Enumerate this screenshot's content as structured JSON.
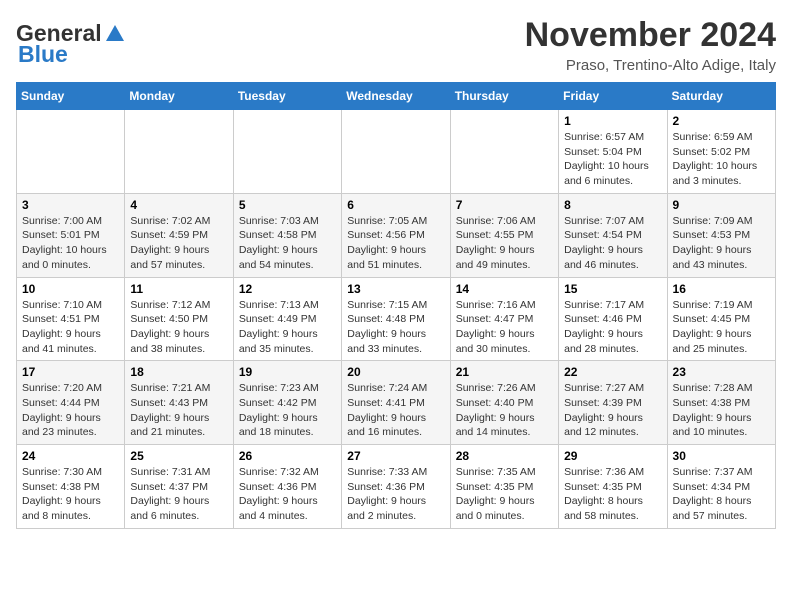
{
  "header": {
    "logo_general": "General",
    "logo_blue": "Blue",
    "month_title": "November 2024",
    "location": "Praso, Trentino-Alto Adige, Italy"
  },
  "weekdays": [
    "Sunday",
    "Monday",
    "Tuesday",
    "Wednesday",
    "Thursday",
    "Friday",
    "Saturday"
  ],
  "weeks": [
    [
      {
        "day": "",
        "info": ""
      },
      {
        "day": "",
        "info": ""
      },
      {
        "day": "",
        "info": ""
      },
      {
        "day": "",
        "info": ""
      },
      {
        "day": "",
        "info": ""
      },
      {
        "day": "1",
        "info": "Sunrise: 6:57 AM\nSunset: 5:04 PM\nDaylight: 10 hours and 6 minutes."
      },
      {
        "day": "2",
        "info": "Sunrise: 6:59 AM\nSunset: 5:02 PM\nDaylight: 10 hours and 3 minutes."
      }
    ],
    [
      {
        "day": "3",
        "info": "Sunrise: 7:00 AM\nSunset: 5:01 PM\nDaylight: 10 hours and 0 minutes."
      },
      {
        "day": "4",
        "info": "Sunrise: 7:02 AM\nSunset: 4:59 PM\nDaylight: 9 hours and 57 minutes."
      },
      {
        "day": "5",
        "info": "Sunrise: 7:03 AM\nSunset: 4:58 PM\nDaylight: 9 hours and 54 minutes."
      },
      {
        "day": "6",
        "info": "Sunrise: 7:05 AM\nSunset: 4:56 PM\nDaylight: 9 hours and 51 minutes."
      },
      {
        "day": "7",
        "info": "Sunrise: 7:06 AM\nSunset: 4:55 PM\nDaylight: 9 hours and 49 minutes."
      },
      {
        "day": "8",
        "info": "Sunrise: 7:07 AM\nSunset: 4:54 PM\nDaylight: 9 hours and 46 minutes."
      },
      {
        "day": "9",
        "info": "Sunrise: 7:09 AM\nSunset: 4:53 PM\nDaylight: 9 hours and 43 minutes."
      }
    ],
    [
      {
        "day": "10",
        "info": "Sunrise: 7:10 AM\nSunset: 4:51 PM\nDaylight: 9 hours and 41 minutes."
      },
      {
        "day": "11",
        "info": "Sunrise: 7:12 AM\nSunset: 4:50 PM\nDaylight: 9 hours and 38 minutes."
      },
      {
        "day": "12",
        "info": "Sunrise: 7:13 AM\nSunset: 4:49 PM\nDaylight: 9 hours and 35 minutes."
      },
      {
        "day": "13",
        "info": "Sunrise: 7:15 AM\nSunset: 4:48 PM\nDaylight: 9 hours and 33 minutes."
      },
      {
        "day": "14",
        "info": "Sunrise: 7:16 AM\nSunset: 4:47 PM\nDaylight: 9 hours and 30 minutes."
      },
      {
        "day": "15",
        "info": "Sunrise: 7:17 AM\nSunset: 4:46 PM\nDaylight: 9 hours and 28 minutes."
      },
      {
        "day": "16",
        "info": "Sunrise: 7:19 AM\nSunset: 4:45 PM\nDaylight: 9 hours and 25 minutes."
      }
    ],
    [
      {
        "day": "17",
        "info": "Sunrise: 7:20 AM\nSunset: 4:44 PM\nDaylight: 9 hours and 23 minutes."
      },
      {
        "day": "18",
        "info": "Sunrise: 7:21 AM\nSunset: 4:43 PM\nDaylight: 9 hours and 21 minutes."
      },
      {
        "day": "19",
        "info": "Sunrise: 7:23 AM\nSunset: 4:42 PM\nDaylight: 9 hours and 18 minutes."
      },
      {
        "day": "20",
        "info": "Sunrise: 7:24 AM\nSunset: 4:41 PM\nDaylight: 9 hours and 16 minutes."
      },
      {
        "day": "21",
        "info": "Sunrise: 7:26 AM\nSunset: 4:40 PM\nDaylight: 9 hours and 14 minutes."
      },
      {
        "day": "22",
        "info": "Sunrise: 7:27 AM\nSunset: 4:39 PM\nDaylight: 9 hours and 12 minutes."
      },
      {
        "day": "23",
        "info": "Sunrise: 7:28 AM\nSunset: 4:38 PM\nDaylight: 9 hours and 10 minutes."
      }
    ],
    [
      {
        "day": "24",
        "info": "Sunrise: 7:30 AM\nSunset: 4:38 PM\nDaylight: 9 hours and 8 minutes."
      },
      {
        "day": "25",
        "info": "Sunrise: 7:31 AM\nSunset: 4:37 PM\nDaylight: 9 hours and 6 minutes."
      },
      {
        "day": "26",
        "info": "Sunrise: 7:32 AM\nSunset: 4:36 PM\nDaylight: 9 hours and 4 minutes."
      },
      {
        "day": "27",
        "info": "Sunrise: 7:33 AM\nSunset: 4:36 PM\nDaylight: 9 hours and 2 minutes."
      },
      {
        "day": "28",
        "info": "Sunrise: 7:35 AM\nSunset: 4:35 PM\nDaylight: 9 hours and 0 minutes."
      },
      {
        "day": "29",
        "info": "Sunrise: 7:36 AM\nSunset: 4:35 PM\nDaylight: 8 hours and 58 minutes."
      },
      {
        "day": "30",
        "info": "Sunrise: 7:37 AM\nSunset: 4:34 PM\nDaylight: 8 hours and 57 minutes."
      }
    ]
  ]
}
